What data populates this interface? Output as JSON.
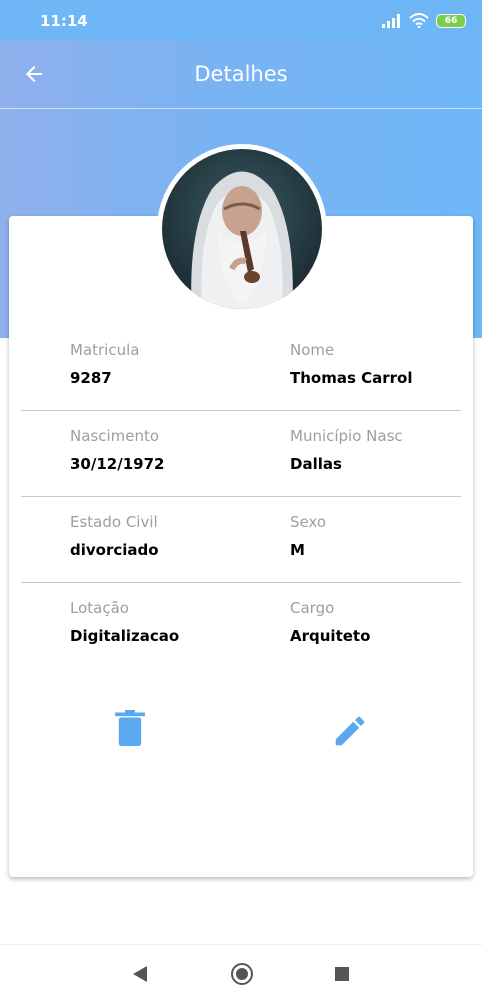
{
  "status_bar": {
    "time": "11:14",
    "battery": "66"
  },
  "appbar": {
    "title": "Detalhes",
    "back_icon": "arrow-left-icon"
  },
  "profile": {
    "avatar_icon": "profile-photo"
  },
  "fields": [
    {
      "left": {
        "label": "Matricula",
        "value": "9287"
      },
      "right": {
        "label": "Nome",
        "value": "Thomas Carrol"
      }
    },
    {
      "left": {
        "label": "Nascimento",
        "value": "30/12/1972"
      },
      "right": {
        "label": "Município Nasc",
        "value": "Dallas"
      }
    },
    {
      "left": {
        "label": "Estado Civil",
        "value": "divorciado"
      },
      "right": {
        "label": "Sexo",
        "value": "M"
      }
    },
    {
      "left": {
        "label": "Lotação",
        "value": "Digitalizacao"
      },
      "right": {
        "label": "Cargo",
        "value": "Arquiteto"
      }
    }
  ],
  "actions": {
    "delete_icon": "trash-icon",
    "edit_icon": "pencil-icon"
  },
  "colors": {
    "accent": "#6fb6f7",
    "icon": "#5aa9f0"
  },
  "navigation": {
    "back": "back-triangle-icon",
    "home": "home-circle-icon",
    "recents": "recents-square-icon"
  }
}
